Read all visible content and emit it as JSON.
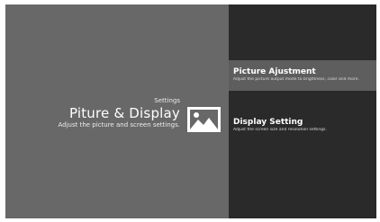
{
  "header": {
    "breadcrumb": "Settings",
    "title": "Piture & Display",
    "subtitle": "Adjust the picture and screen settings."
  },
  "hero": {
    "icon": "image-icon",
    "icon_color": "#ffffff"
  },
  "menu": {
    "items": [
      {
        "label": "Picture Ajustment",
        "description": "Adjust the picture output mode to brightness, color and more.",
        "active": true
      },
      {
        "label": "Display Setting",
        "description": "Adjust the screen size and resolution settings.",
        "active": false
      }
    ]
  },
  "colors": {
    "left_panel": "#686868",
    "right_panel": "#2a2a2a",
    "active_item": "#5e5e5e"
  }
}
